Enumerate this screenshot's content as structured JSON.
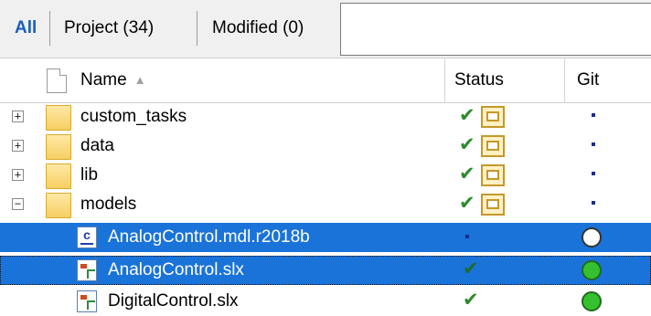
{
  "filter_tabs": {
    "all": "All",
    "project": "Project (34)",
    "modified": "Modified (0)"
  },
  "filter_input": {
    "value": ""
  },
  "columns": {
    "name": "Name",
    "status": "Status",
    "git": "Git"
  },
  "rows": [
    {
      "name": "custom_tasks",
      "type": "folder",
      "expander": "+",
      "status": "in project (folder)",
      "git": "dot"
    },
    {
      "name": "data",
      "type": "folder",
      "expander": "+",
      "status": "in project (folder)",
      "git": "dot"
    },
    {
      "name": "lib",
      "type": "folder",
      "expander": "+",
      "status": "in project (folder)",
      "git": "dot"
    },
    {
      "name": "models",
      "type": "folder",
      "expander": "−",
      "status": "in project (folder)",
      "git": "dot"
    },
    {
      "name": "AnalogControl.mdl.r2018b",
      "type": "mdl-file",
      "selected": true,
      "status": "dot",
      "git": "empty-circle"
    },
    {
      "name": "AnalogControl.slx",
      "type": "slx-file",
      "selected": true,
      "status": "check",
      "git": "green-circle"
    },
    {
      "name": "DigitalControl.slx",
      "type": "slx-file",
      "status": "check",
      "git": "green-circle"
    }
  ],
  "glyphs": {
    "check": "✔",
    "sort_ascending": "▲"
  },
  "colors": {
    "selection": "#1a73d9",
    "accent": "#1a5fb4",
    "git_ok": "#35c12f"
  }
}
